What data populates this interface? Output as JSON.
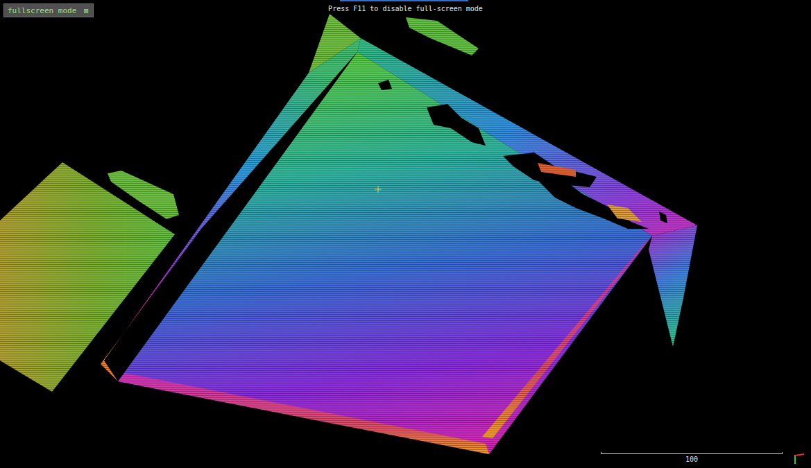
{
  "toolbar": {
    "label": "fullscreen mode",
    "close": "⊠"
  },
  "hint": "Press F11 to disable full-screen mode",
  "scale_bar": {
    "label": "100"
  }
}
